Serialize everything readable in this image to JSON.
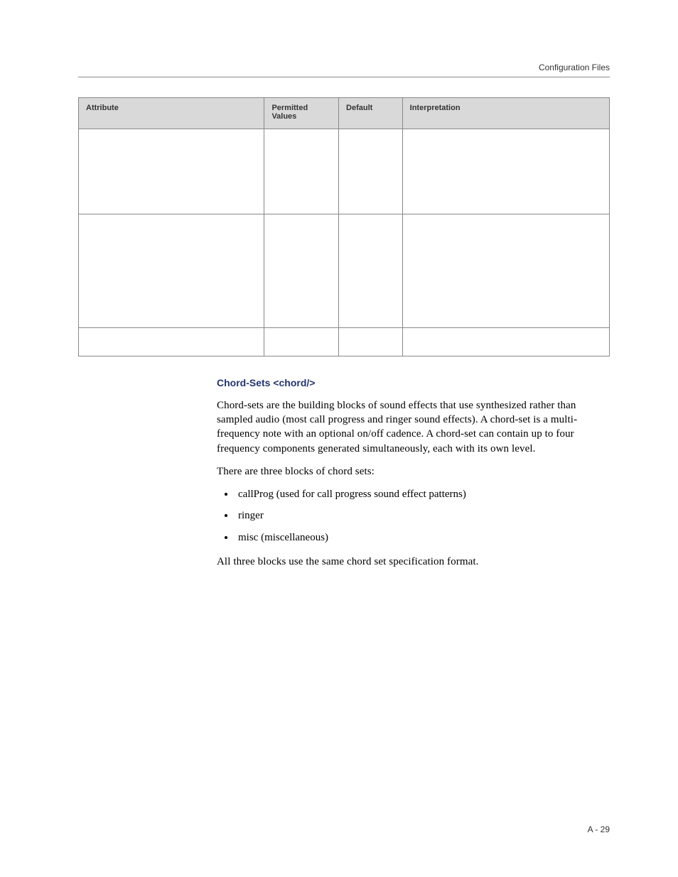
{
  "header": {
    "running_title": "Configuration Files"
  },
  "table": {
    "headers": [
      "Attribute",
      "Permitted Values",
      "Default",
      "Interpretation"
    ],
    "rows": [
      [
        "",
        "",
        "",
        ""
      ],
      [
        "",
        "",
        "",
        ""
      ],
      [
        "",
        "",
        "",
        ""
      ]
    ]
  },
  "section": {
    "subhead": "Chord-Sets <chord/>",
    "para1": "Chord-sets are the building blocks of sound effects that use synthesized rather than sampled audio (most call progress and ringer sound effects). A chord-set is a multi-frequency note with an optional on/off cadence. A chord-set can contain up to four frequency components generated simultaneously, each with its own level.",
    "para2": "There are three blocks of chord sets:",
    "bullets": [
      "callProg (used for call progress sound effect patterns)",
      "ringer",
      "misc (miscellaneous)"
    ],
    "para3": "All three blocks use the same chord set specification format."
  },
  "footer": {
    "page_number": "A - 29"
  }
}
